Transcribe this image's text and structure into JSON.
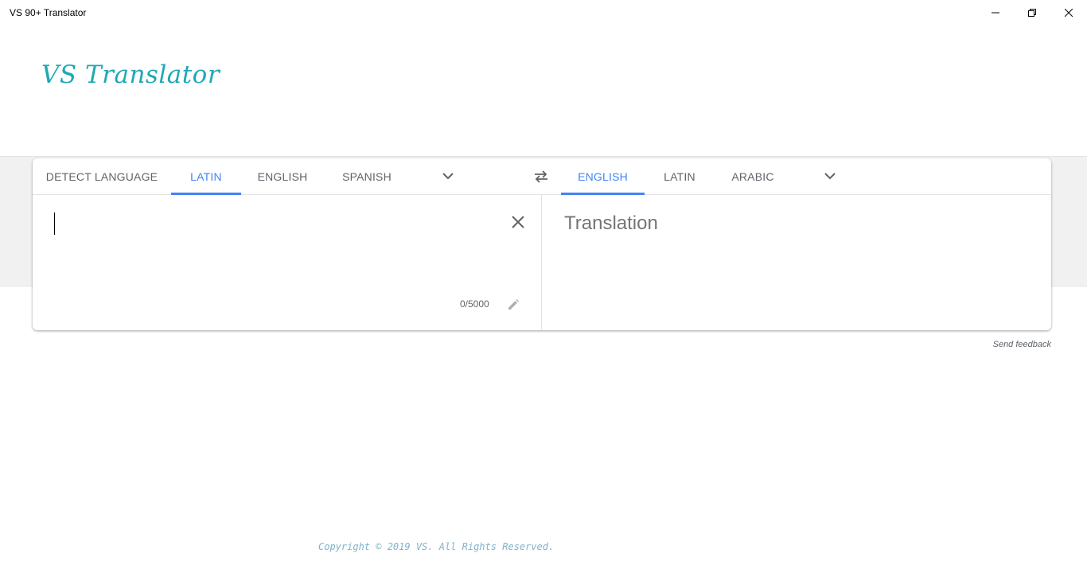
{
  "window": {
    "title": "VS 90+ Translator",
    "controls": [
      "minimize-icon",
      "restore-icon",
      "close-icon"
    ]
  },
  "app": {
    "logo_text": "VS Translator",
    "logo_color": "#1fa8b4"
  },
  "source": {
    "tabs": [
      {
        "label": "DETECT LANGUAGE",
        "active": false
      },
      {
        "label": "LATIN",
        "active": true
      },
      {
        "label": "ENGLISH",
        "active": false
      },
      {
        "label": "SPANISH",
        "active": false
      }
    ],
    "more_icon": "chevron-down-icon",
    "input_value": "",
    "clear_icon": "close-icon",
    "char_count": "0/5000",
    "edit_icon": "pencil-icon"
  },
  "swap_icon": "swap-arrows-icon",
  "target": {
    "tabs": [
      {
        "label": "ENGLISH",
        "active": true
      },
      {
        "label": "LATIN",
        "active": false
      },
      {
        "label": "ARABIC",
        "active": false
      }
    ],
    "more_icon": "chevron-down-icon",
    "placeholder": "Translation"
  },
  "feedback_link": "Send feedback",
  "footer": {
    "copyright": "Copyright © 2019 VS. All Rights Reserved."
  },
  "colors": {
    "accent": "#4285f4",
    "tab_text": "#5f6368",
    "band_bg": "#f1f1f1"
  }
}
